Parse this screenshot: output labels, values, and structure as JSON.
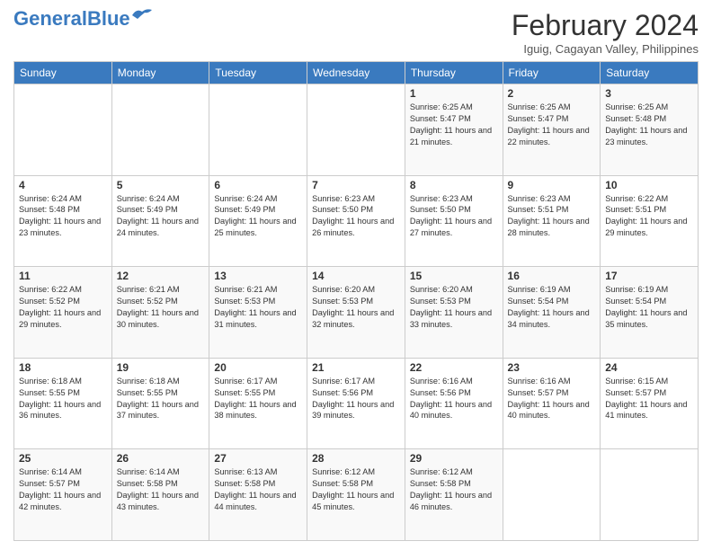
{
  "header": {
    "logo_general": "General",
    "logo_blue": "Blue",
    "month_title": "February 2024",
    "location": "Iguig, Cagayan Valley, Philippines"
  },
  "days_of_week": [
    "Sunday",
    "Monday",
    "Tuesday",
    "Wednesday",
    "Thursday",
    "Friday",
    "Saturday"
  ],
  "weeks": [
    [
      {
        "day": "",
        "info": ""
      },
      {
        "day": "",
        "info": ""
      },
      {
        "day": "",
        "info": ""
      },
      {
        "day": "",
        "info": ""
      },
      {
        "day": "1",
        "info": "Sunrise: 6:25 AM\nSunset: 5:47 PM\nDaylight: 11 hours and 21 minutes."
      },
      {
        "day": "2",
        "info": "Sunrise: 6:25 AM\nSunset: 5:47 PM\nDaylight: 11 hours and 22 minutes."
      },
      {
        "day": "3",
        "info": "Sunrise: 6:25 AM\nSunset: 5:48 PM\nDaylight: 11 hours and 23 minutes."
      }
    ],
    [
      {
        "day": "4",
        "info": "Sunrise: 6:24 AM\nSunset: 5:48 PM\nDaylight: 11 hours and 23 minutes."
      },
      {
        "day": "5",
        "info": "Sunrise: 6:24 AM\nSunset: 5:49 PM\nDaylight: 11 hours and 24 minutes."
      },
      {
        "day": "6",
        "info": "Sunrise: 6:24 AM\nSunset: 5:49 PM\nDaylight: 11 hours and 25 minutes."
      },
      {
        "day": "7",
        "info": "Sunrise: 6:23 AM\nSunset: 5:50 PM\nDaylight: 11 hours and 26 minutes."
      },
      {
        "day": "8",
        "info": "Sunrise: 6:23 AM\nSunset: 5:50 PM\nDaylight: 11 hours and 27 minutes."
      },
      {
        "day": "9",
        "info": "Sunrise: 6:23 AM\nSunset: 5:51 PM\nDaylight: 11 hours and 28 minutes."
      },
      {
        "day": "10",
        "info": "Sunrise: 6:22 AM\nSunset: 5:51 PM\nDaylight: 11 hours and 29 minutes."
      }
    ],
    [
      {
        "day": "11",
        "info": "Sunrise: 6:22 AM\nSunset: 5:52 PM\nDaylight: 11 hours and 29 minutes."
      },
      {
        "day": "12",
        "info": "Sunrise: 6:21 AM\nSunset: 5:52 PM\nDaylight: 11 hours and 30 minutes."
      },
      {
        "day": "13",
        "info": "Sunrise: 6:21 AM\nSunset: 5:53 PM\nDaylight: 11 hours and 31 minutes."
      },
      {
        "day": "14",
        "info": "Sunrise: 6:20 AM\nSunset: 5:53 PM\nDaylight: 11 hours and 32 minutes."
      },
      {
        "day": "15",
        "info": "Sunrise: 6:20 AM\nSunset: 5:53 PM\nDaylight: 11 hours and 33 minutes."
      },
      {
        "day": "16",
        "info": "Sunrise: 6:19 AM\nSunset: 5:54 PM\nDaylight: 11 hours and 34 minutes."
      },
      {
        "day": "17",
        "info": "Sunrise: 6:19 AM\nSunset: 5:54 PM\nDaylight: 11 hours and 35 minutes."
      }
    ],
    [
      {
        "day": "18",
        "info": "Sunrise: 6:18 AM\nSunset: 5:55 PM\nDaylight: 11 hours and 36 minutes."
      },
      {
        "day": "19",
        "info": "Sunrise: 6:18 AM\nSunset: 5:55 PM\nDaylight: 11 hours and 37 minutes."
      },
      {
        "day": "20",
        "info": "Sunrise: 6:17 AM\nSunset: 5:55 PM\nDaylight: 11 hours and 38 minutes."
      },
      {
        "day": "21",
        "info": "Sunrise: 6:17 AM\nSunset: 5:56 PM\nDaylight: 11 hours and 39 minutes."
      },
      {
        "day": "22",
        "info": "Sunrise: 6:16 AM\nSunset: 5:56 PM\nDaylight: 11 hours and 40 minutes."
      },
      {
        "day": "23",
        "info": "Sunrise: 6:16 AM\nSunset: 5:57 PM\nDaylight: 11 hours and 40 minutes."
      },
      {
        "day": "24",
        "info": "Sunrise: 6:15 AM\nSunset: 5:57 PM\nDaylight: 11 hours and 41 minutes."
      }
    ],
    [
      {
        "day": "25",
        "info": "Sunrise: 6:14 AM\nSunset: 5:57 PM\nDaylight: 11 hours and 42 minutes."
      },
      {
        "day": "26",
        "info": "Sunrise: 6:14 AM\nSunset: 5:58 PM\nDaylight: 11 hours and 43 minutes."
      },
      {
        "day": "27",
        "info": "Sunrise: 6:13 AM\nSunset: 5:58 PM\nDaylight: 11 hours and 44 minutes."
      },
      {
        "day": "28",
        "info": "Sunrise: 6:12 AM\nSunset: 5:58 PM\nDaylight: 11 hours and 45 minutes."
      },
      {
        "day": "29",
        "info": "Sunrise: 6:12 AM\nSunset: 5:58 PM\nDaylight: 11 hours and 46 minutes."
      },
      {
        "day": "",
        "info": ""
      },
      {
        "day": "",
        "info": ""
      }
    ]
  ]
}
